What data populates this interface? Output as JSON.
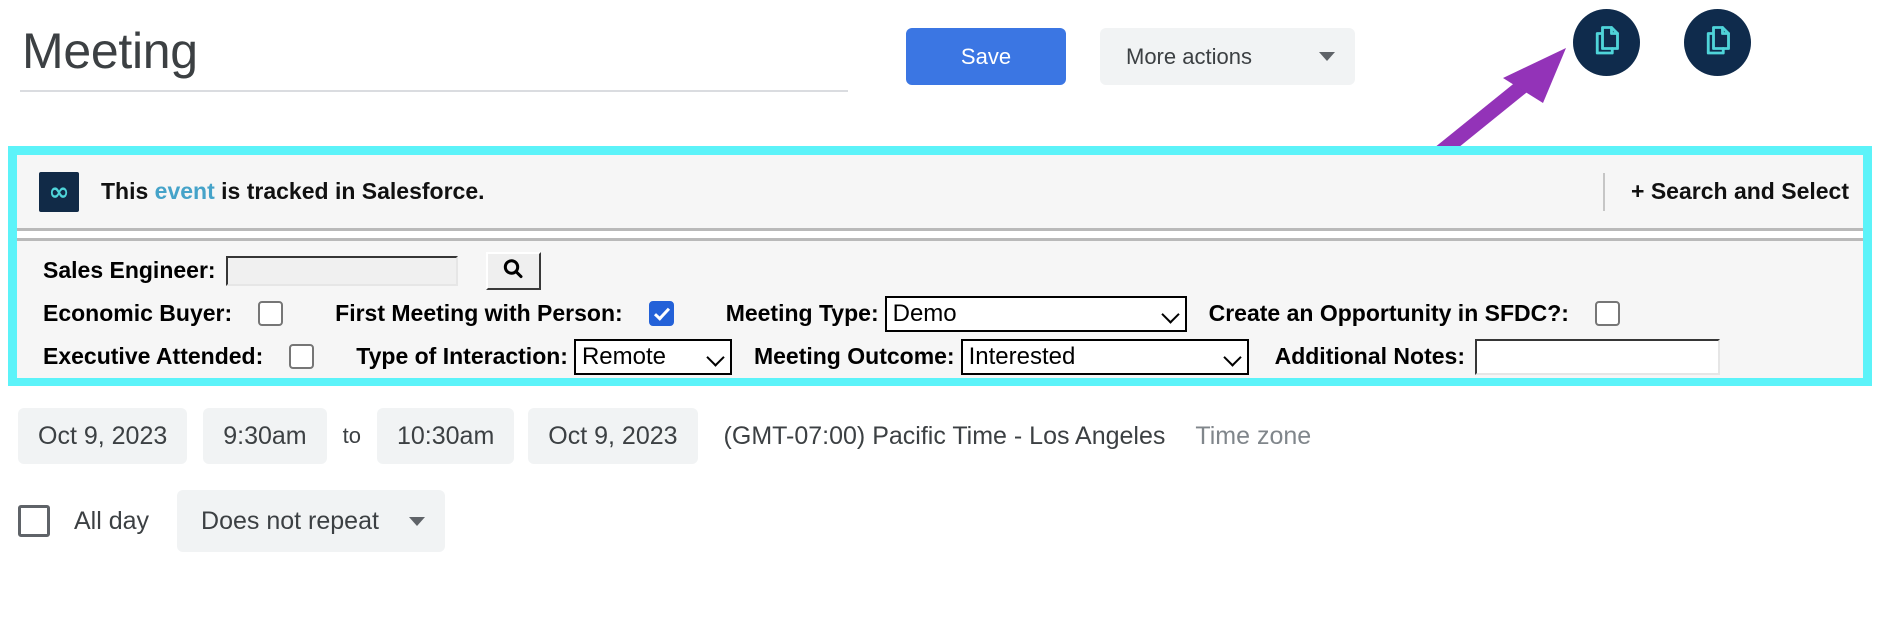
{
  "header": {
    "title": "Meeting",
    "save_label": "Save",
    "more_actions_label": "More actions",
    "caret_icon": "chevron-down-icon",
    "circle_button_1_icon": "copy-documents-icon",
    "circle_button_2_icon": "copy-documents-icon",
    "annotation_arrow": "purple-arrow-pointing-to-first-circle-button"
  },
  "salesforce_banner": {
    "logo_glyph": "∞",
    "text_prefix": "This ",
    "link_text": "event",
    "text_suffix": " is tracked in Salesforce.",
    "search_and_select_label": "+ Search and Select",
    "border_color": "#5cf3f9",
    "background_color": "#f6f6f6",
    "link_color": "#45a3c9",
    "logo_background": "#112a47",
    "logo_color": "#4fd4d9"
  },
  "salesforce_form": {
    "sales_engineer": {
      "label": "Sales Engineer:",
      "value": "",
      "search_icon": "search-icon"
    },
    "economic_buyer": {
      "label": "Economic Buyer:",
      "checked": false
    },
    "first_meeting_with_person": {
      "label": "First Meeting with Person:",
      "checked": true
    },
    "meeting_type": {
      "label": "Meeting Type:",
      "value": "Demo",
      "options": [
        "Demo"
      ]
    },
    "create_opportunity_in_sfdc": {
      "label": "Create an Opportunity in SFDC?:",
      "checked": false
    },
    "executive_attended": {
      "label": "Executive Attended:",
      "checked": false
    },
    "type_of_interaction": {
      "label": "Type of Interaction:",
      "value": "Remote",
      "options": [
        "Remote"
      ]
    },
    "meeting_outcome": {
      "label": "Meeting Outcome:",
      "value": "Interested",
      "options": [
        "Interested"
      ]
    },
    "additional_notes": {
      "label": "Additional Notes:",
      "value": ""
    },
    "checkbox_accent_color": "#2361d8"
  },
  "schedule": {
    "start_date": "Oct 9, 2023",
    "start_time": "9:30am",
    "to_word": "to",
    "end_time": "10:30am",
    "end_date": "Oct 9, 2023",
    "timezone_value": "(GMT-07:00) Pacific Time - Los Angeles",
    "timezone_label": "Time zone",
    "all_day_label": "All day",
    "all_day_checked": false,
    "recurrence_value": "Does not repeat",
    "recurrence_caret_icon": "chevron-down-icon"
  },
  "colors": {
    "save_blue": "#3b76e3",
    "chip_gray": "#f1f3f4",
    "text_primary": "#3c4043",
    "text_muted": "#80868b",
    "circle_navy": "#0f2b4c",
    "icon_teal": "#4fd4d9",
    "arrow_purple": "#9333b8"
  }
}
